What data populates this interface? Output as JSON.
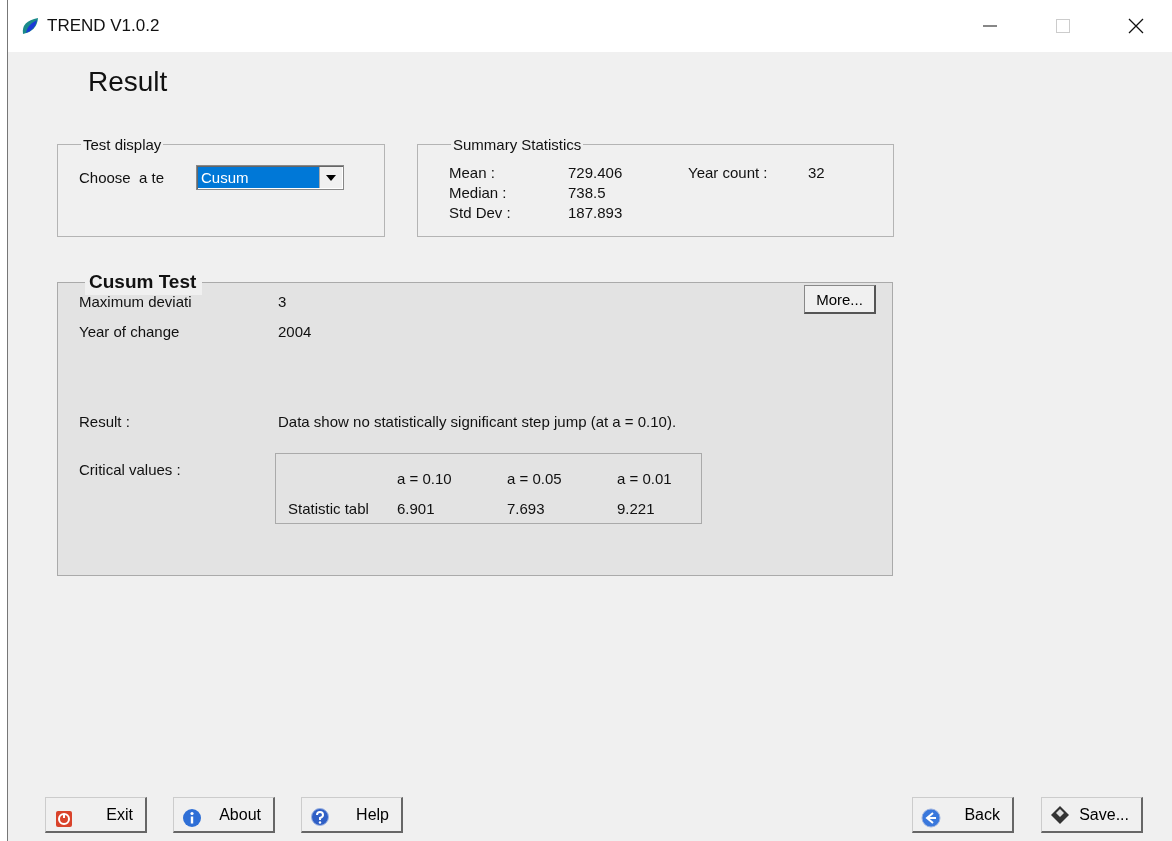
{
  "window": {
    "title": "TREND V1.0.2"
  },
  "heading": "Result",
  "test_display": {
    "title": "Test display",
    "label": "Choose  a te",
    "value": "Cusum"
  },
  "summary": {
    "title": "Summary Statistics",
    "stats": [
      {
        "label": "Mean :",
        "value": "729.406"
      },
      {
        "label": "Median :",
        "value": "738.5"
      },
      {
        "label": "Std Dev :",
        "value": "187.893"
      }
    ],
    "year_count": {
      "label": "Year count :",
      "value": "32"
    }
  },
  "test": {
    "title": "Cusum Test",
    "more_button": "More...",
    "rows": [
      {
        "label": "Maximum deviati",
        "value": "3"
      },
      {
        "label": "Year of change",
        "value": "2004"
      }
    ],
    "result": {
      "label": "Result :",
      "value": "Data show no statistically significant step jump (at a = 0.10)."
    },
    "critical": {
      "label": "Critical values :",
      "columns": [
        "a = 0.10",
        "a = 0.05",
        "a = 0.01"
      ],
      "row_label": "Statistic tabl",
      "values": [
        "6.901",
        "7.693",
        "9.221"
      ]
    }
  },
  "buttons_left": [
    {
      "label": "Exit",
      "kind": "exit"
    },
    {
      "label": "About",
      "kind": "info"
    },
    {
      "label": "Help",
      "kind": "help"
    }
  ],
  "buttons_right": [
    {
      "label": "Back",
      "kind": "back"
    },
    {
      "label": "Save...",
      "kind": "save"
    }
  ]
}
